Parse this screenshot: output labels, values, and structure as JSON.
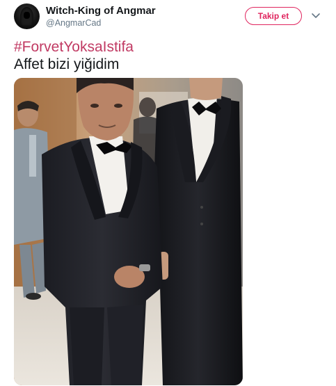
{
  "tweet": {
    "author": {
      "display_name": "Witch-King of Angmar",
      "screen_name": "@AngmarCad",
      "avatar_icon": "witch-king-avatar"
    },
    "follow_label": "Takip et",
    "menu_icon": "chevron-down-icon",
    "hashtag": "#ForvetYoksaIstifa",
    "text": "Affet bizi yiğidim",
    "accent_color": "#e0245e",
    "hashtag_color": "#c13a63",
    "photo": {
      "description_icon": "photo-two-men-in-tuxedos"
    }
  }
}
